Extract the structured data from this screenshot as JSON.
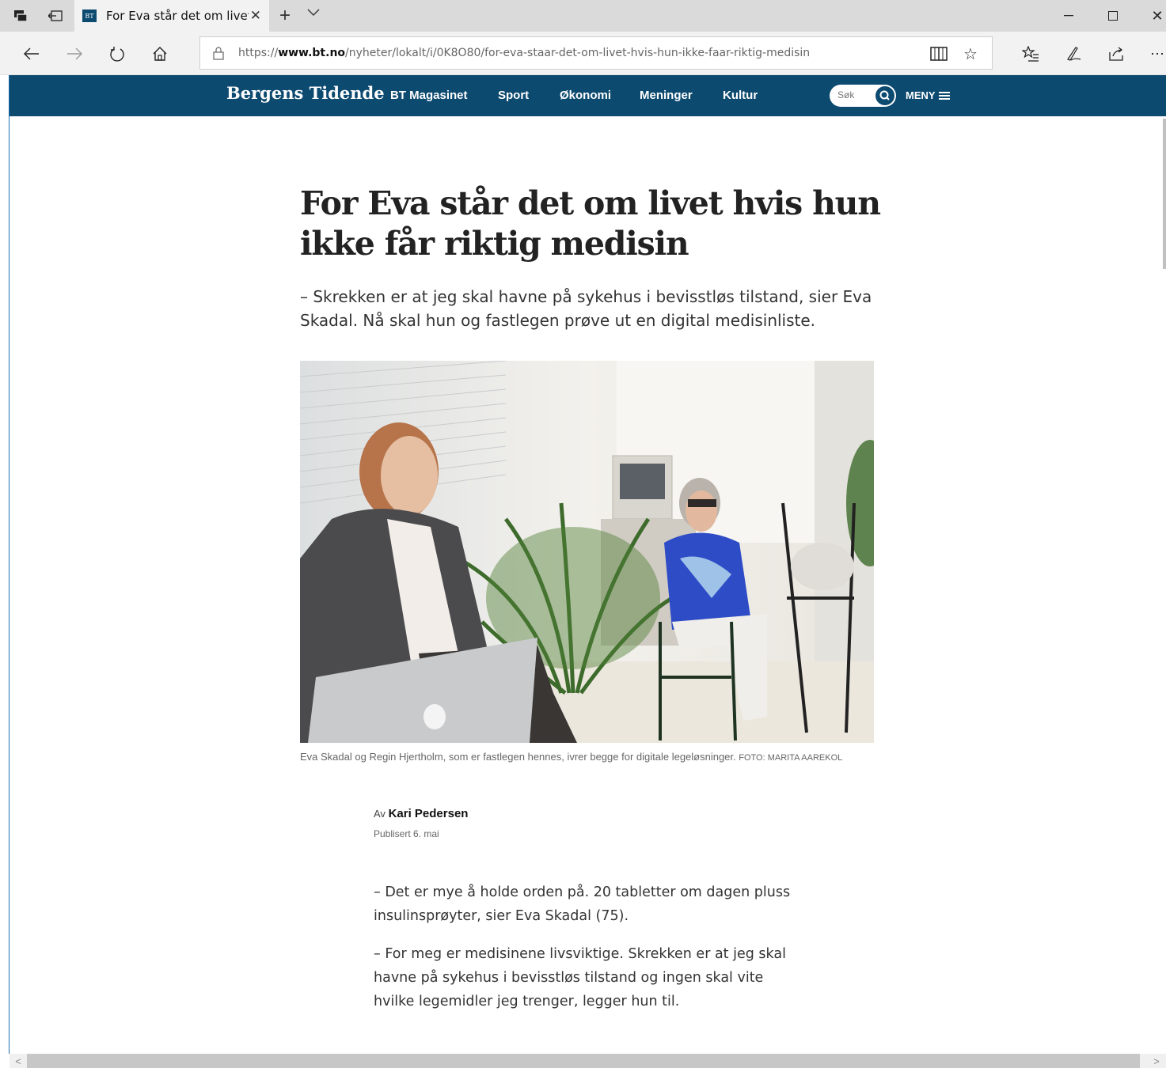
{
  "browser": {
    "tab_title": "For Eva står det om livet hvis hun ikke får riktig medisin",
    "favicon_text": "BT",
    "url_prefix": "https://",
    "url_domain": "www.bt.no",
    "url_path": "/nyheter/lokalt/i/0K8O80/for-eva-staar-det-om-livet-hvis-hun-ikke-faar-riktig-medisin"
  },
  "site": {
    "logo": "Bergens Tidende",
    "nav": [
      "BT Magasinet",
      "Sport",
      "Økonomi",
      "Meninger",
      "Kultur"
    ],
    "search_placeholder": "Søk",
    "menu_label": "MENY",
    "brand_color": "#0d4a70"
  },
  "article": {
    "headline": "For Eva står det om livet hvis hun ikke får riktig medisin",
    "lead": "– Skrekken er at jeg skal havne på sykehus i bevisstløs tilstand, sier Eva Skadal. Nå skal hun og fastlegen prøve ut en digital medisinliste.",
    "caption": "Eva Skadal og Regin Hjertholm, som er fastlegen hennes, ivrer begge for digitale legeløsninger.",
    "photo_credit": "FOTO: MARITA AAREKOL",
    "byline_prefix": "Av",
    "author": "Kari Pedersen",
    "published": "Publisert 6. mai",
    "paragraphs": [
      "– Det er mye å holde orden på. 20 tabletter om dagen pluss insulinsprøyter, sier Eva Skadal (75).",
      "– For meg er medisinene livsviktige. Skrekken er at jeg skal havne på sykehus i bevisstløs tilstand og ingen skal vite hvilke legemidler jeg trenger, legger hun til."
    ]
  }
}
